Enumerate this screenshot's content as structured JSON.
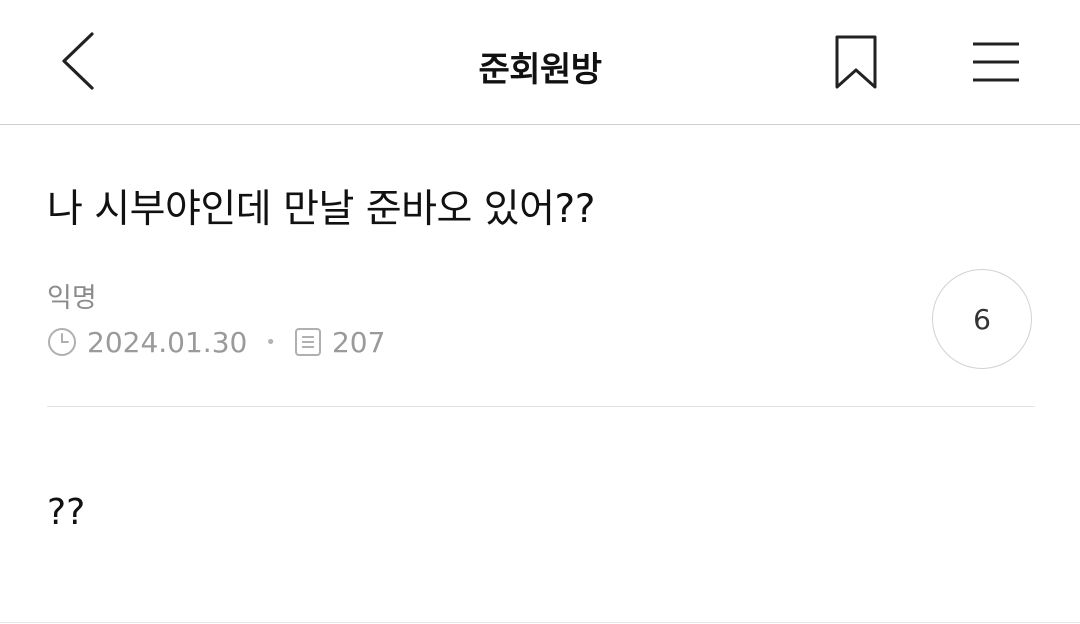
{
  "header": {
    "board_title": "준회원방",
    "back_icon": "chevron-left-icon",
    "bookmark_icon": "bookmark-icon",
    "menu_icon": "hamburger-menu-icon"
  },
  "post": {
    "title": "나 시부야인데 만날 준바오 있어??",
    "author": "익명",
    "date": "2024.01.30",
    "views": "207",
    "comment_count": "6",
    "body": "??"
  }
}
